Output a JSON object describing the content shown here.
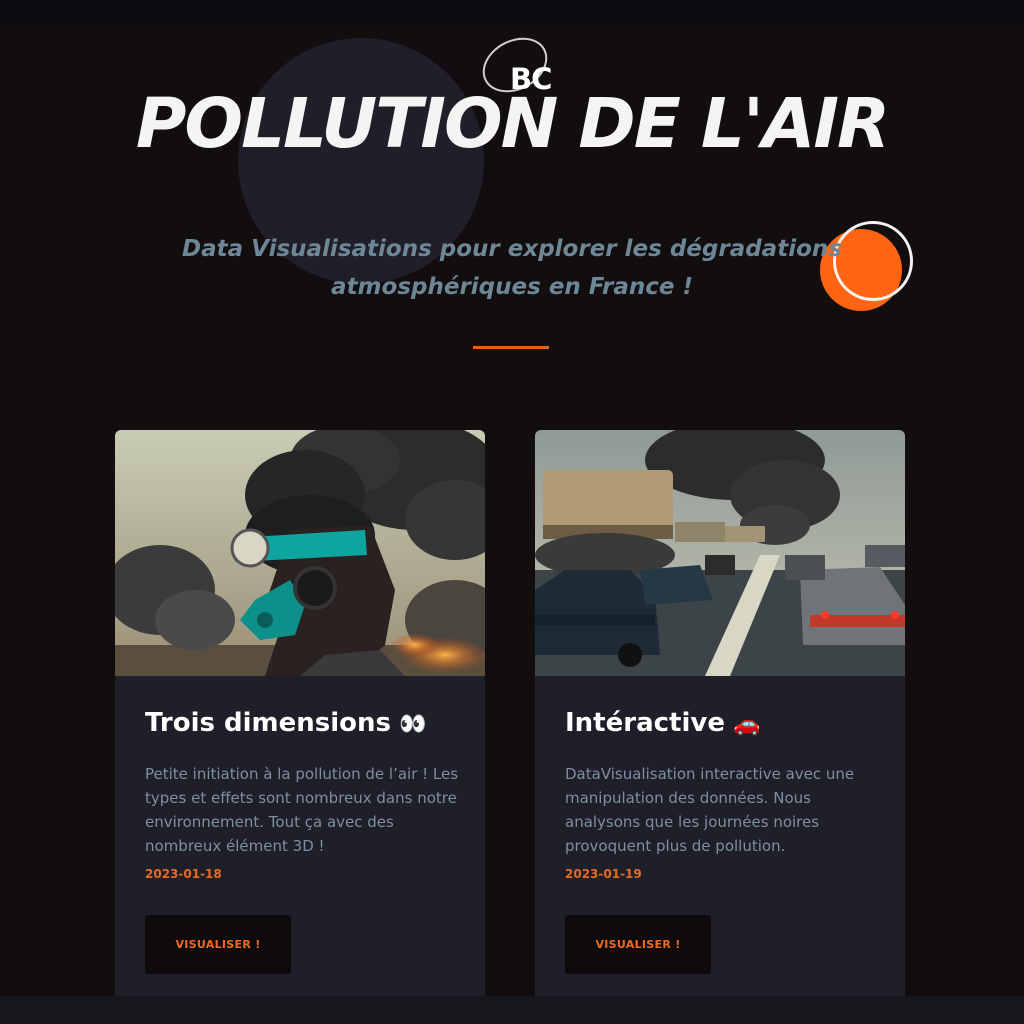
{
  "header": {
    "logo_text": "BC",
    "title": "POLLUTION DE L'AIR",
    "subtitle_line1": "Data Visualisations pour explorer les dégradations",
    "subtitle_line2": "atmosphériques en France !",
    "accent_color": "#ff6412"
  },
  "cards": [
    {
      "title": "Trois dimensions",
      "emoji": "👀",
      "image_icon": "gas-mask-portrait-image",
      "description": "Petite initiation à la pollution de l’air ! Les types et effets sont nombreux dans notre environnement. Tout ça avec des nombreux élément 3D !",
      "date": "2023-01-18",
      "button_label": "VISUALISER !"
    },
    {
      "title": "Intéractive",
      "emoji": "🚗",
      "image_icon": "traffic-jam-image",
      "description": "DataVisualisation interactive avec une manipulation des données. Nous analysons que les journées noires provoquent plus de pollution.",
      "date": "2023-01-19",
      "button_label": "VISUALISER !"
    }
  ]
}
